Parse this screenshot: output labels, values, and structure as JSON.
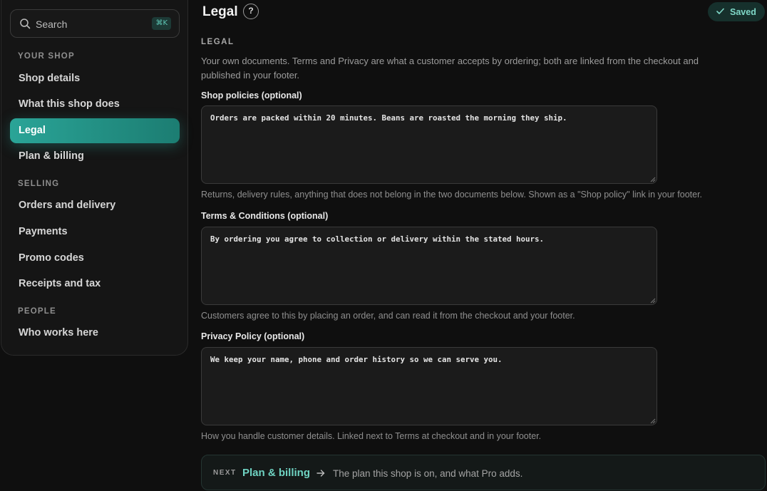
{
  "search": {
    "label": "Search",
    "shortcut": "⌘K"
  },
  "sidebar": {
    "sections": [
      {
        "label": "YOUR SHOP"
      },
      {
        "label": "SELLING"
      },
      {
        "label": "PEOPLE"
      }
    ],
    "items": [
      {
        "label": "Shop details"
      },
      {
        "label": "What this shop does"
      },
      {
        "label": "Legal",
        "active": true
      },
      {
        "label": "Plan & billing"
      },
      {
        "label": "Orders and delivery"
      },
      {
        "label": "Payments"
      },
      {
        "label": "Promo codes"
      },
      {
        "label": "Receipts and tax"
      },
      {
        "label": "Who works here"
      }
    ]
  },
  "header": {
    "title": "Legal",
    "help": "?",
    "status": "Saved"
  },
  "main": {
    "eyebrow": "LEGAL",
    "intro": "Your own documents. Terms and Privacy are what a customer accepts by ordering; both are linked from the checkout and published in your footer.",
    "fields": [
      {
        "label": "Shop policies (optional)",
        "value": "Orders are packed within 20 minutes. Beans are roasted the morning they ship.",
        "help": "Returns, delivery rules, anything that does not belong in the two documents below. Shown as a \"Shop policy\" link in your footer."
      },
      {
        "label": "Terms & Conditions (optional)",
        "value": "By ordering you agree to collection or delivery within the stated hours.",
        "help": "Customers agree to this by placing an order, and can read it from the checkout and your footer."
      },
      {
        "label": "Privacy Policy (optional)",
        "value": "We keep your name, phone and order history so we can serve you.",
        "help": "How you handle customer details. Linked next to Terms at checkout and in your footer."
      }
    ],
    "next": {
      "kicker": "NEXT",
      "target": "Plan & billing",
      "description": "The plan this shop is on, and what Pro adds."
    }
  },
  "colors": {
    "accent": "#2aa497",
    "accent_text": "#6fd3c2",
    "background": "#0f0f0f"
  },
  "icons": {
    "search": "search-icon",
    "help": "help-icon",
    "saved": "check-icon",
    "next": "arrow-right-icon"
  }
}
